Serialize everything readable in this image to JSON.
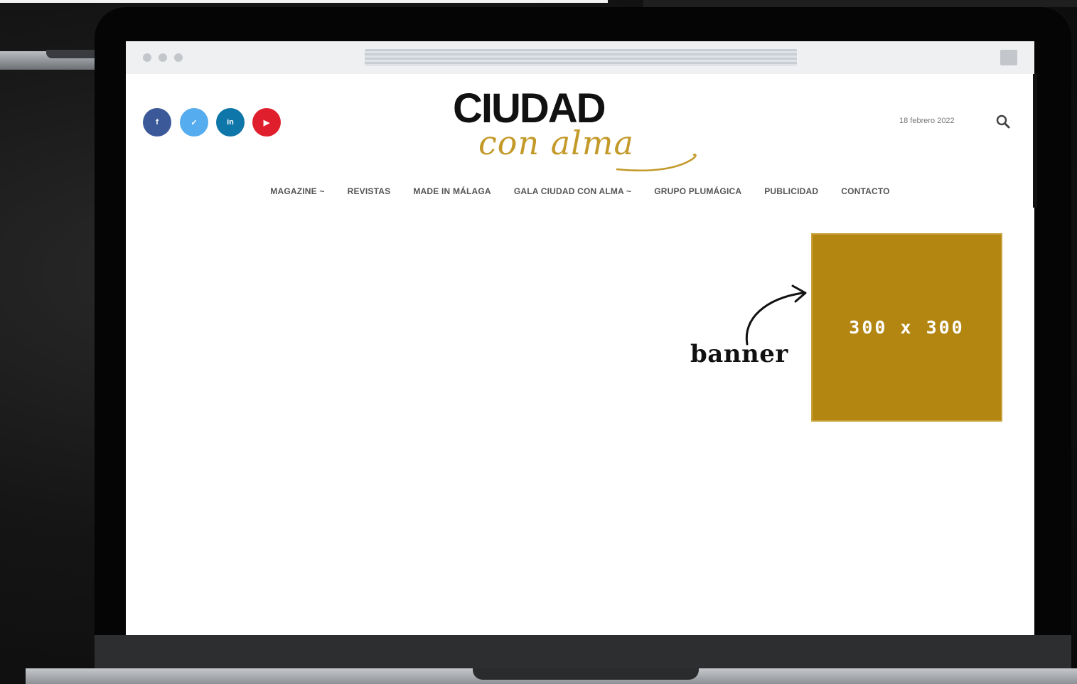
{
  "header": {
    "social": [
      {
        "network": "facebook",
        "glyph": "f"
      },
      {
        "network": "twitter",
        "glyph": "✓"
      },
      {
        "network": "linkedin",
        "glyph": "in"
      },
      {
        "network": "youtube",
        "glyph": "▶"
      }
    ],
    "logo_main": "CIUDAD",
    "logo_script": "con alma",
    "date": "18 febrero 2022"
  },
  "nav": {
    "items": [
      "MAGAZINE ~",
      "REVISTAS",
      "MADE IN MÁLAGA",
      "GALA CIUDAD CON ALMA ~",
      "GRUPO PLUMÁGICA",
      "PUBLICIDAD",
      "CONTACTO"
    ]
  },
  "banner": {
    "size_label": "300 x 300",
    "annotation": "banner",
    "color": "#b38612"
  },
  "icons": {
    "search": "search-icon",
    "arrow": "curved-arrow-icon"
  }
}
